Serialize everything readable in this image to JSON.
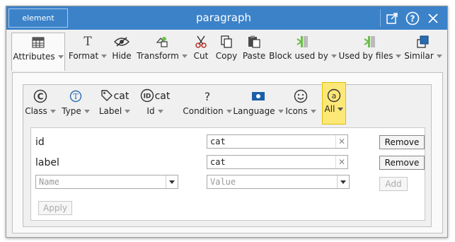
{
  "titlebar": {
    "element_tab": "element",
    "title": "paragraph",
    "icons": [
      "edit-icon",
      "help-icon",
      "close-icon"
    ]
  },
  "toolbar": {
    "items": [
      {
        "label": "Attributes",
        "icon": "table-grid-icon"
      },
      {
        "label": "Format",
        "icon": "text-format-icon"
      },
      {
        "label": "Hide",
        "icon": "eye-slash-icon"
      },
      {
        "label": "Transform",
        "icon": "transform-icon"
      },
      {
        "label": "Cut",
        "icon": "scissors-icon"
      },
      {
        "label": "Copy",
        "icon": "copy-icon"
      },
      {
        "label": "Paste",
        "icon": "paste-icon"
      },
      {
        "label": "Block used by",
        "icon": "block-used-by-icon"
      },
      {
        "label": "Used by files",
        "icon": "used-by-files-icon"
      },
      {
        "label": "Similar",
        "icon": "similar-icon"
      }
    ]
  },
  "subtoolbar": {
    "items": [
      {
        "label": "Class",
        "icon": "copyright-icon",
        "badge": ""
      },
      {
        "label": "Type",
        "icon": "t-circle-icon",
        "badge": ""
      },
      {
        "label": "Label",
        "icon": "tag-icon",
        "badge": "cat"
      },
      {
        "label": "Id",
        "icon": "id-icon",
        "badge": "cat"
      },
      {
        "label": "Condition",
        "icon": "question-icon",
        "badge": ""
      },
      {
        "label": "Language",
        "icon": "flag-icon",
        "badge": ""
      },
      {
        "label": "Icons",
        "icon": "smiley-icon",
        "badge": ""
      },
      {
        "label": "All",
        "icon": "at-sign-icon",
        "badge": ""
      }
    ]
  },
  "attributes": {
    "rows": [
      {
        "name": "id",
        "value": "cat",
        "remove_label": "Remove"
      },
      {
        "name": "label",
        "value": "cat",
        "remove_label": "Remove"
      }
    ],
    "new_row": {
      "name_placeholder": "Name",
      "value_placeholder": "Value",
      "add_label": "Add"
    },
    "apply_label": "Apply"
  },
  "colors": {
    "titlebar": "#3b82c9",
    "active_subtab": "#fde877",
    "window_bg": "#f0f0f0"
  }
}
